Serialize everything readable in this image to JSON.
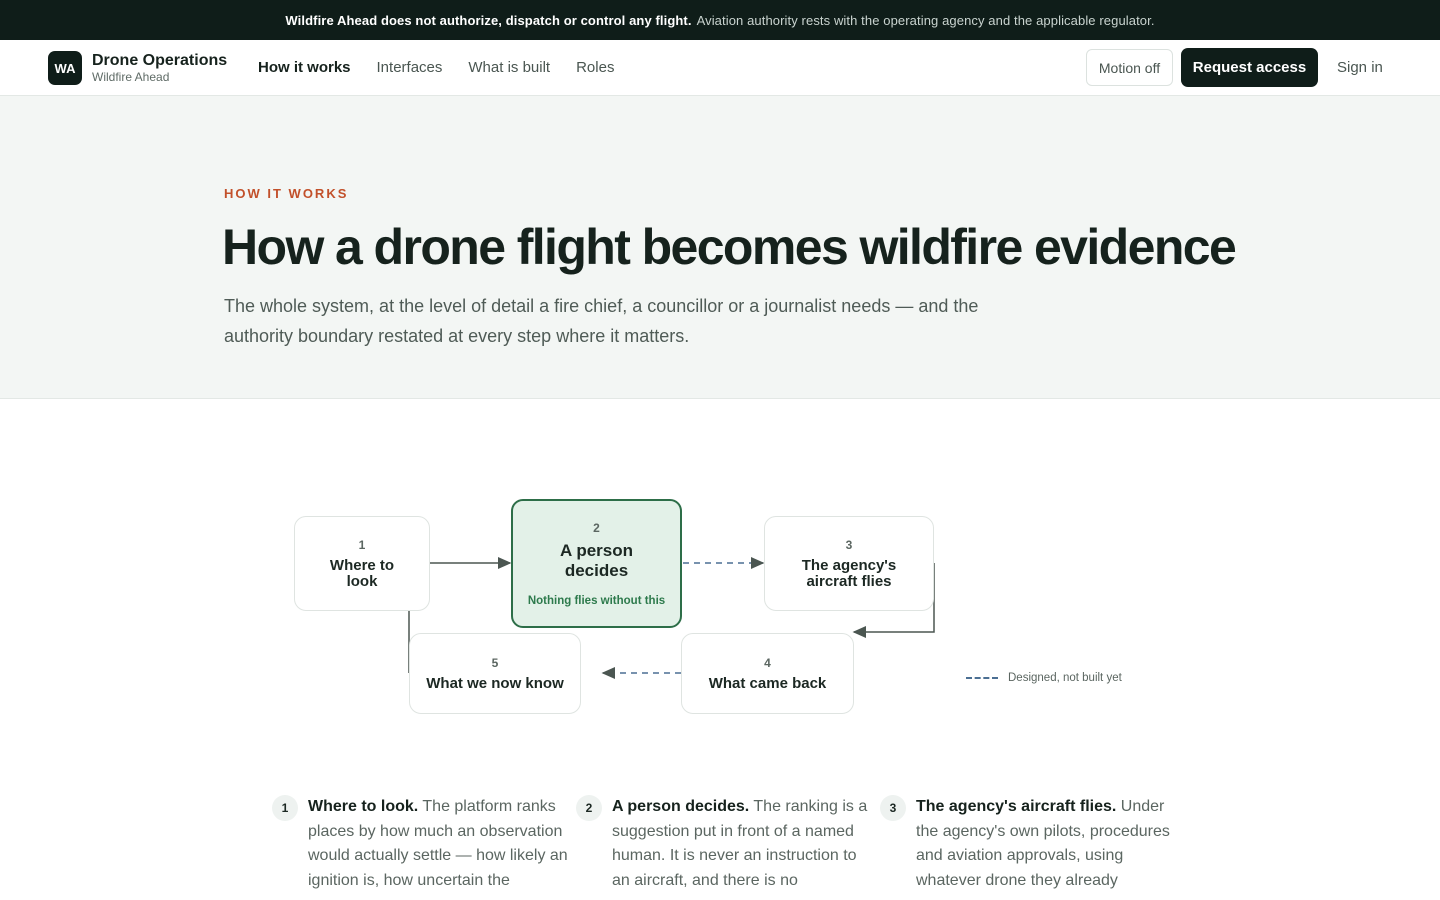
{
  "banner": {
    "strong": "Wildfire Ahead does not authorize, dispatch or control any flight.",
    "text": "Aviation authority rests with the operating agency and the applicable regulator."
  },
  "header": {
    "logo": "WA",
    "brand_title": "Drone Operations",
    "brand_sub": "Wildfire Ahead",
    "nav": [
      "How it works",
      "Interfaces",
      "What is built",
      "Roles"
    ],
    "motion_label": "Motion off",
    "request_label": "Request access",
    "signin_label": "Sign in"
  },
  "hero": {
    "eyebrow": "HOW IT WORKS",
    "title": "How a drone flight becomes wildfire evidence",
    "lede": "The whole system, at the level of detail a fire chief, a councillor or a journalist needs — and the authority boundary restated at every step where it matters."
  },
  "diagram": {
    "nodes": [
      {
        "num": "1",
        "title": "Where to look"
      },
      {
        "num": "2",
        "title": "A person decides",
        "sub": "Nothing flies without this"
      },
      {
        "num": "3",
        "title": "The agency's aircraft flies"
      },
      {
        "num": "4",
        "title": "What came back"
      },
      {
        "num": "5",
        "title": "What we now know"
      }
    ],
    "legend": "Designed, not built yet"
  },
  "steps": [
    {
      "num": "1",
      "title": "Where to look.",
      "text": "The platform ranks places by how much an observation would actually settle — how likely an ignition is, how uncertain the"
    },
    {
      "num": "2",
      "title": "A person decides.",
      "text": "The ranking is a suggestion put in front of a named human. It is never an instruction to an aircraft, and there is no"
    },
    {
      "num": "3",
      "title": "The agency's aircraft flies.",
      "text": "Under the agency's own pilots, procedures and aviation approvals, using whatever drone they already"
    }
  ],
  "colors": {
    "banner_bg": "#0f1d19",
    "accent_orange": "#c2502a",
    "active_green": "#2d6e48",
    "dashed_blue": "#4b6f93"
  }
}
